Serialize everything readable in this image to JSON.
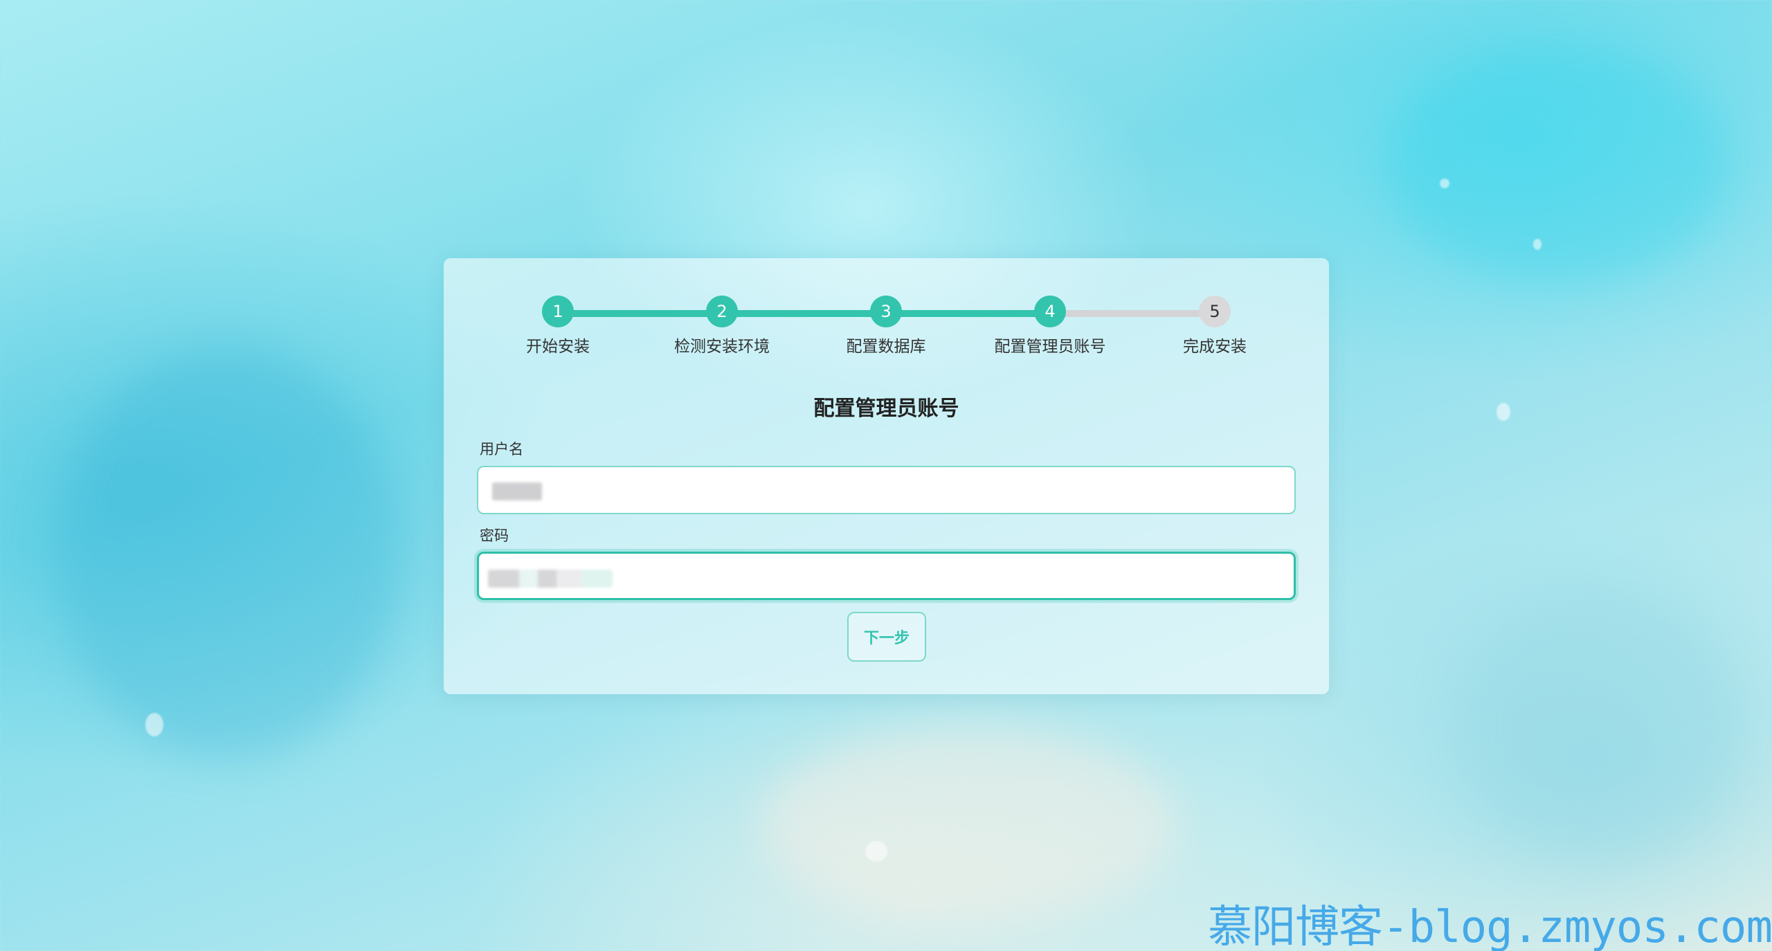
{
  "steps": [
    {
      "number": "1",
      "label": "开始安装",
      "state": "done"
    },
    {
      "number": "2",
      "label": "检测安装环境",
      "state": "done"
    },
    {
      "number": "3",
      "label": "配置数据库",
      "state": "done"
    },
    {
      "number": "4",
      "label": "配置管理员账号",
      "state": "current"
    },
    {
      "number": "5",
      "label": "完成安装",
      "state": "todo"
    }
  ],
  "form": {
    "title": "配置管理员账号",
    "username_label": "用户名",
    "password_label": "密码",
    "next_button": "下一步"
  },
  "watermark": "慕阳博客-blog.zmyos.com",
  "colors": {
    "accent": "#33c4ad",
    "pending": "#d9d9db",
    "watermark": "#3fa6e8"
  }
}
